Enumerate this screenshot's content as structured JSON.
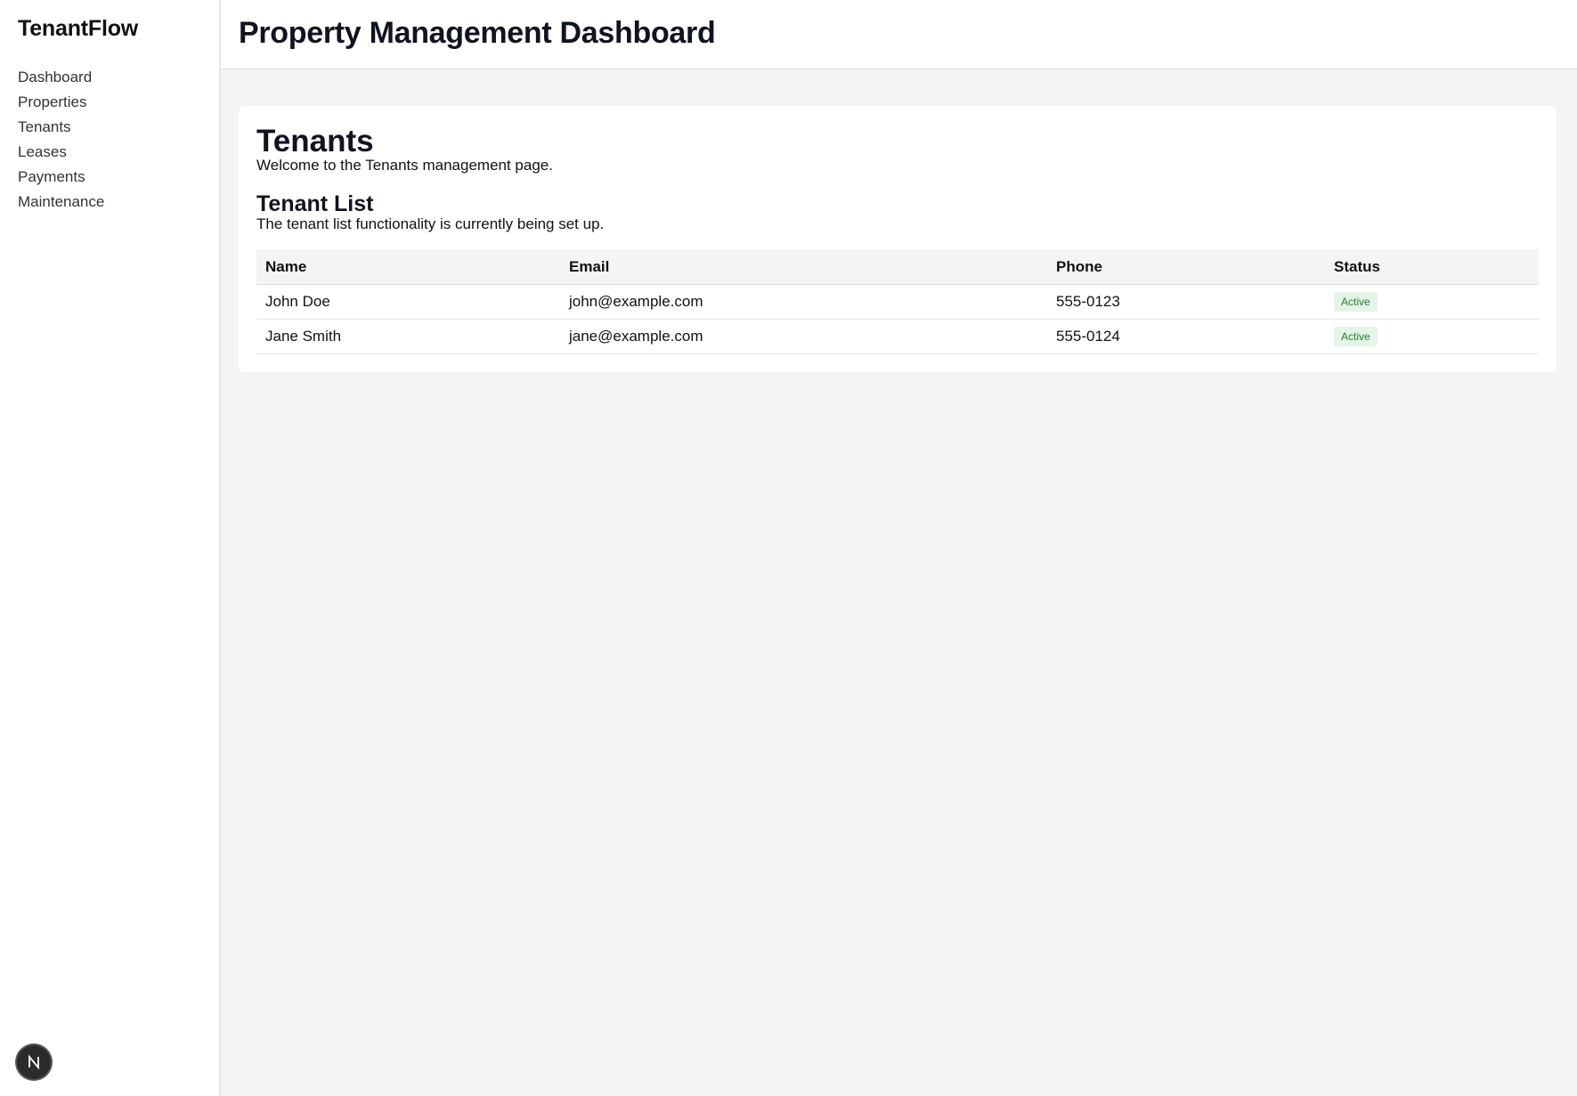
{
  "sidebar": {
    "brand": "TenantFlow",
    "items": [
      {
        "label": "Dashboard"
      },
      {
        "label": "Properties"
      },
      {
        "label": "Tenants"
      },
      {
        "label": "Leases"
      },
      {
        "label": "Payments"
      },
      {
        "label": "Maintenance"
      }
    ],
    "devtools_icon": "nextjs-logo-icon",
    "devtools_label": "N"
  },
  "header": {
    "title": "Property Management Dashboard"
  },
  "main": {
    "heading": "Tenants",
    "intro": "Welcome to the Tenants management page.",
    "list_heading": "Tenant List",
    "list_note": "The tenant list functionality is currently being set up.",
    "table": {
      "columns": [
        "Name",
        "Email",
        "Phone",
        "Status"
      ],
      "rows": [
        {
          "name": "John Doe",
          "email": "john@example.com",
          "phone": "555-0123",
          "status": "Active"
        },
        {
          "name": "Jane Smith",
          "email": "jane@example.com",
          "phone": "555-0124",
          "status": "Active"
        }
      ]
    }
  },
  "colors": {
    "status_active_bg": "#e4f4e6",
    "status_active_text": "#2e7d32",
    "page_bg": "#f4f4f4"
  }
}
